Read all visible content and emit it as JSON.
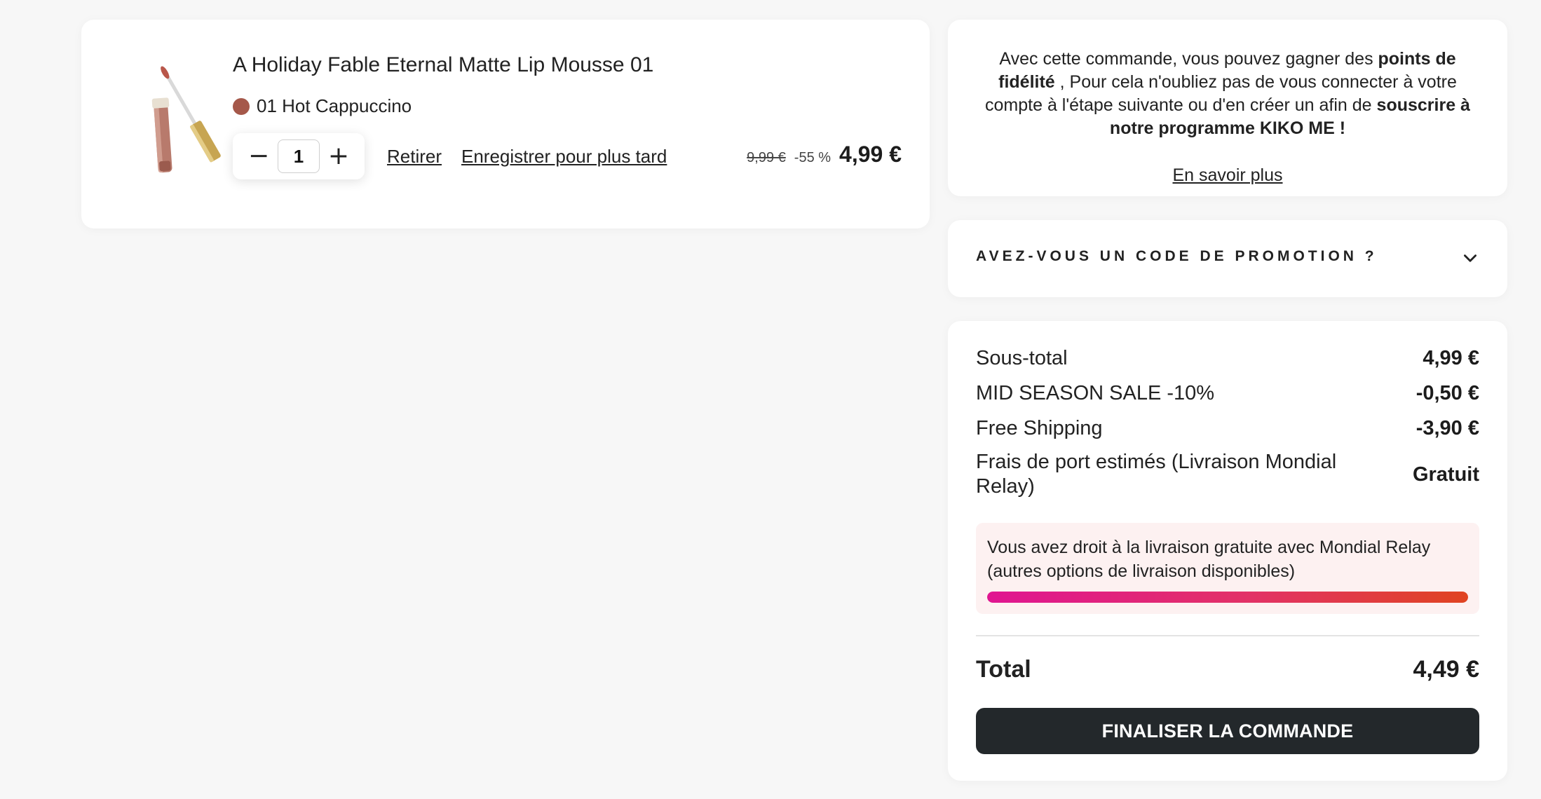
{
  "product": {
    "title": "A Holiday Fable Eternal Matte Lip Mousse 01",
    "shade_name": "01 Hot Cappuccino",
    "shade_color": "#a5584a",
    "image_icon": "lip-mousse-product-image",
    "quantity": "1",
    "decrease_icon": "minus-icon",
    "increase_icon": "plus-icon",
    "remove_label": "Retirer",
    "save_later_label": "Enregistrer pour plus tard",
    "price_old": "9,99 €",
    "discount": "-55 %",
    "price_new": "4,99 €"
  },
  "loyalty": {
    "text_part1": "Avec cette commande, vous pouvez gagner des ",
    "text_bold1": "points de fidélité",
    "text_part2": " , Pour cela n'oubliez pas de vous connecter à votre compte à l'étape suivante ou d'en créer un afin de ",
    "text_bold2": "souscrire à notre programme KIKO ME !",
    "link_label": "En savoir plus"
  },
  "promo": {
    "label": "AVEZ-VOUS UN CODE DE PROMOTION ?",
    "icon": "chevron-down-icon"
  },
  "summary": {
    "subtotal_label": "Sous-total",
    "subtotal_value": "4,99 €",
    "sale_label": "MID SEASON SALE -10%",
    "sale_value": "-0,50 €",
    "free_shipping_label": "Free Shipping",
    "free_shipping_value": "-3,90 €",
    "shipping_label": "Frais de port estimés (Livraison Mondial Relay)",
    "shipping_value": "Gratuit",
    "notice_text": "Vous avez droit à la livraison gratuite avec Mondial Relay (autres options de livraison disponibles)",
    "progress_percent": 100,
    "total_label": "Total",
    "total_value": "4,49 €",
    "checkout_label": "FINALISER LA COMMANDE"
  },
  "colors": {
    "accent_dark": "#23282b",
    "progress_start": "#e01591",
    "progress_end": "#e04421",
    "notice_bg": "#fdf1f1"
  }
}
